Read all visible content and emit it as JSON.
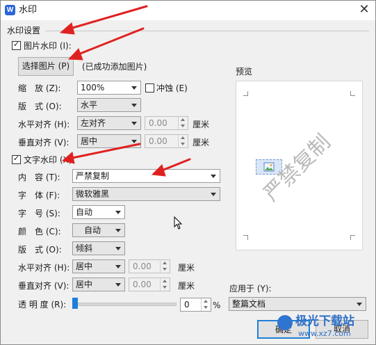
{
  "window": {
    "title": "水印",
    "logo": "W",
    "close_glyph": "✕"
  },
  "section": {
    "title": "水印设置"
  },
  "picture": {
    "checkbox_label": "图片水印 (I):",
    "checked": true,
    "select_button": "选择图片 (P)",
    "status": "(已成功添加图片)",
    "scale_label": "缩　放 (Z):",
    "scale_value": "100%",
    "washout_label": "冲蚀 (E)",
    "layout_label": "版　式 (O):",
    "layout_value": "水平",
    "halign_label": "水平对齐 (H):",
    "halign_value": "左对齐",
    "halign_offset": "0.00",
    "valign_label": "垂直对齐 (V):",
    "valign_value": "居中",
    "valign_offset": "0.00",
    "unit": "厘米"
  },
  "text": {
    "checkbox_label": "文字水印 (X)",
    "checked": true,
    "content_label": "内　容 (T):",
    "content_value": "严禁复制",
    "font_label": "字　体 (F):",
    "font_value": "微软雅黑",
    "size_label": "字　号 (S):",
    "size_value": "自动",
    "color_label": "颜　色 (C):",
    "color_value": "自动",
    "layout_label": "版　式 (O):",
    "layout_value": "倾斜",
    "halign_label": "水平对齐 (H):",
    "halign_value": "居中",
    "halign_offset": "0.00",
    "valign_label": "垂直对齐 (V):",
    "valign_value": "居中",
    "valign_offset": "0.00",
    "unit": "厘米",
    "transparency_label": "透 明 度 (R):",
    "transparency_value": "0",
    "transparency_unit": "%",
    "transparency_level": 0
  },
  "preview": {
    "title": "预览",
    "watermark_text": "严禁复制"
  },
  "apply": {
    "label": "应用于 (Y):",
    "value": "整篇文档"
  },
  "buttons": {
    "ok": "确定",
    "cancel": "取消"
  },
  "overlay": {
    "site_logo": "极光下载站",
    "site_url": "www.xz7.com"
  },
  "colors": {
    "accent": "#2b65d9",
    "annotation_arrow": "#e02020"
  }
}
